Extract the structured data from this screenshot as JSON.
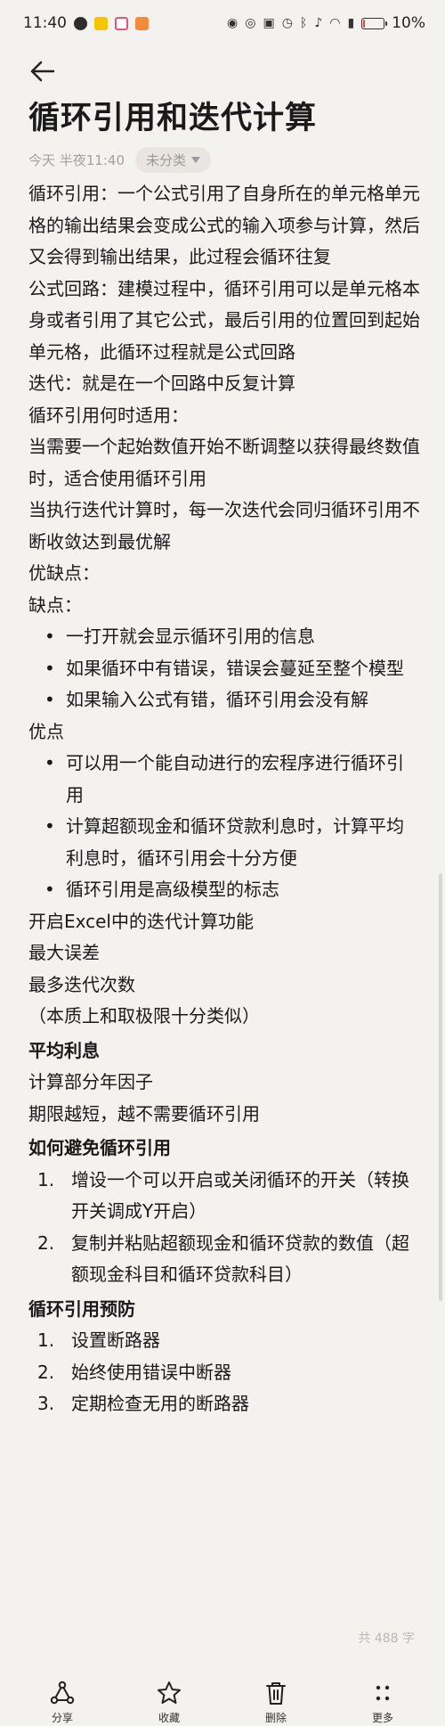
{
  "status_bar": {
    "time": "11:40",
    "battery": "10%",
    "battery_level": 0.1,
    "left_icons": [
      "notification-app-icon",
      "meituan-app-icon",
      "app-icon-pink",
      "app-icon-orange"
    ],
    "right_icons": [
      "eye-icon",
      "hotspot-icon",
      "nfc-icon",
      "alarm-icon",
      "bluetooth-icon",
      "mute-icon",
      "wifi-icon",
      "signal-icon"
    ],
    "colors": {
      "battery_low": "#e0443a"
    }
  },
  "note": {
    "title": "循环引用和迭代计算",
    "date": "今天 半夜11:40",
    "category": "未分类",
    "word_count": "共 488 字"
  },
  "content": {
    "lines": [
      "循环引用：一个公式引用了自身所在的单元格单元格的输出结果会变成公式的输入项参与计算，然后又会得到输出结果，此过程会循环往复",
      "公式回路：建模过程中，循环引用可以是单元格本身或者引用了其它公式，最后引用的位置回到起始单元格，此循环过程就是公式回路",
      "迭代：就是在一个回路中反复计算",
      "循环引用何时适用：",
      "当需要一个起始数值开始不断调整以获得最终数值时，适合使用循环引用",
      "当执行迭代计算时，每一次迭代会同归循环引用不断收敛达到最优解",
      "优缺点：",
      "缺点："
    ],
    "cons": [
      "一打开就会显示循环引用的信息",
      "如果循环中有错误，错误会蔓延至整个模型",
      "如果输入公式有错，循环引用会没有解"
    ],
    "pros_label": "优点",
    "pros": [
      "可以用一个能自动进行的宏程序进行循环引用",
      "计算超额现金和循环贷款利息时，计算平均利息时，循环引用会十分方便",
      "循环引用是高级模型的标志"
    ],
    "lines2": [
      "开启Excel中的迭代计算功能",
      "最大误差",
      "最多迭代次数",
      "（本质上和取极限十分类似）"
    ],
    "heading_avg": "平均利息",
    "lines3": [
      "计算部分年因子",
      "期限越短，越不需要循环引用"
    ],
    "heading_avoid": "如何避免循环引用",
    "avoid": [
      {
        "num": "1.",
        "text": "增设一个可以开启或关闭循环的开关（转换开关调成Y开启）"
      },
      {
        "num": "2.",
        "text": "复制并粘贴超额现金和循环贷款的数值（超额现金科目和循环贷款科目）"
      }
    ],
    "heading_prevent": "循环引用预防",
    "prevent": [
      {
        "num": "1.",
        "text": "设置断路器"
      },
      {
        "num": "2.",
        "text": "始终使用错误中断器"
      },
      {
        "num": "3.",
        "text": "定期检查无用的断路器"
      }
    ]
  },
  "toolbar": {
    "share": "分享",
    "favorite": "收藏",
    "delete": "删除",
    "more": "更多"
  }
}
